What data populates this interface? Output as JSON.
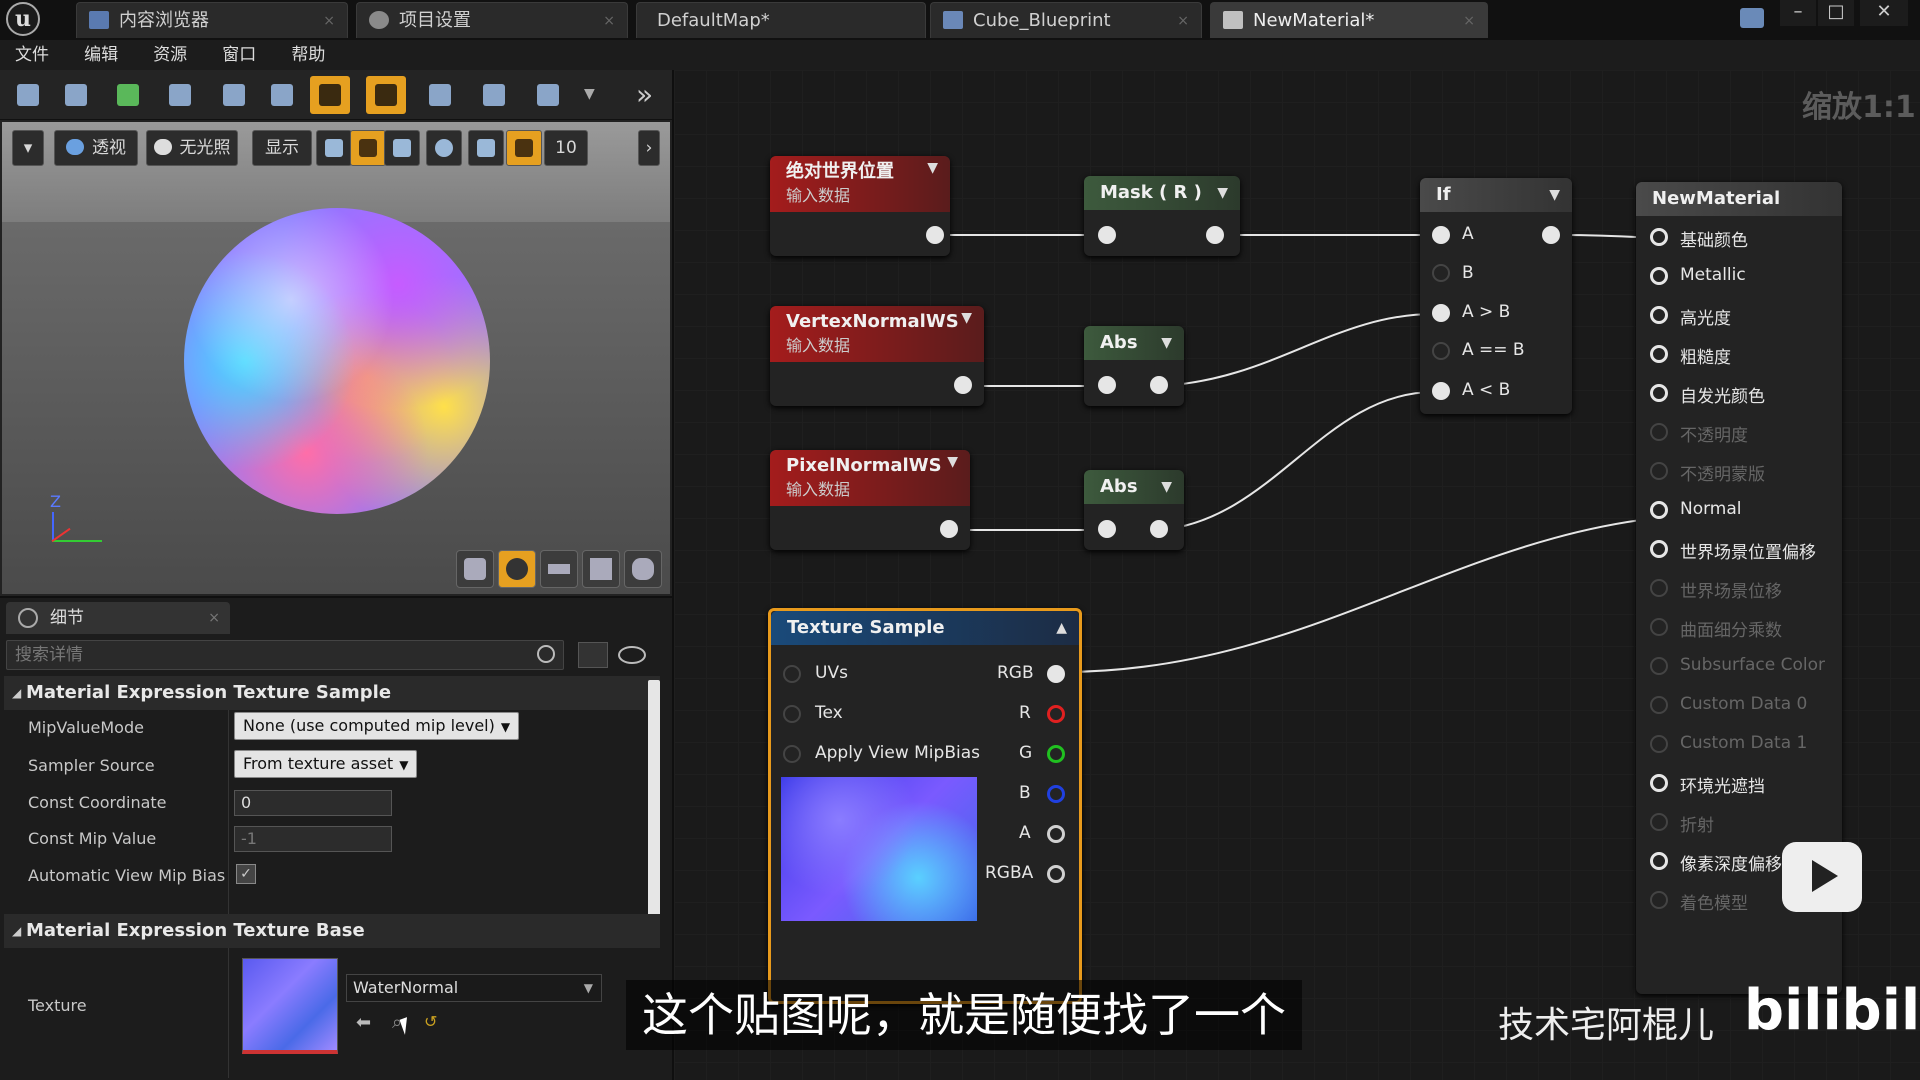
{
  "tabs": [
    {
      "label": "内容浏览器",
      "close": "×"
    },
    {
      "label": "项目设置",
      "close": "×"
    },
    {
      "label": "DefaultMap*"
    },
    {
      "label": "Cube_Blueprint",
      "close": "×"
    },
    {
      "label": "NewMaterial*",
      "close": "×"
    }
  ],
  "window": {
    "minimize": "–",
    "maximize": "□",
    "close": "✕"
  },
  "menu": [
    "文件",
    "编辑",
    "资源",
    "窗口",
    "帮助"
  ],
  "viewport": {
    "perspective": "透视",
    "lit": "无光照",
    "show": "显示",
    "grid_size": "10",
    "axis_label": "Z"
  },
  "details": {
    "tab": "细节",
    "tab_close": "×",
    "search_placeholder": "搜索详情",
    "section1": "Material Expression Texture Sample",
    "section2": "Material Expression Texture Base",
    "props": {
      "mip_value_mode": {
        "label": "MipValueMode",
        "value": "None (use computed mip level)"
      },
      "sampler_source": {
        "label": "Sampler Source",
        "value": "From texture asset"
      },
      "const_coordinate": {
        "label": "Const Coordinate",
        "value": "0"
      },
      "const_mip_value": {
        "label": "Const Mip Value",
        "value": "-1"
      },
      "auto_view_mip_bias": {
        "label": "Automatic View Mip Bias",
        "checked": true
      },
      "texture": {
        "label": "Texture",
        "value": "WaterNormal"
      }
    }
  },
  "graph": {
    "zoom": "缩放1:1",
    "nodes": {
      "abs_world_pos": {
        "title": "绝对世界位置",
        "sub": "输入数据"
      },
      "vertex_normal": {
        "title": "VertexNormalWS",
        "sub": "输入数据"
      },
      "pixel_normal": {
        "title": "PixelNormalWS",
        "sub": "输入数据"
      },
      "mask": {
        "title": "Mask ( R )"
      },
      "abs1": {
        "title": "Abs"
      },
      "abs2": {
        "title": "Abs"
      },
      "if": {
        "title": "If",
        "pins": [
          "A",
          "B",
          "A > B",
          "A == B",
          "A < B"
        ]
      },
      "texture_sample": {
        "title": "Texture Sample",
        "inputs": [
          "UVs",
          "Tex",
          "Apply View MipBias"
        ],
        "outputs": [
          "RGB",
          "R",
          "G",
          "B",
          "A",
          "RGBA"
        ]
      },
      "new_material": {
        "title": "NewMaterial",
        "pins": [
          {
            "label": "基础颜色",
            "active": true
          },
          {
            "label": "Metallic",
            "active": true
          },
          {
            "label": "高光度",
            "active": true
          },
          {
            "label": "粗糙度",
            "active": true
          },
          {
            "label": "自发光颜色",
            "active": true
          },
          {
            "label": "不透明度",
            "active": false
          },
          {
            "label": "不透明蒙版",
            "active": false
          },
          {
            "label": "Normal",
            "active": true
          },
          {
            "label": "世界场景位置偏移",
            "active": true
          },
          {
            "label": "世界场景位移",
            "active": false
          },
          {
            "label": "曲面细分乘数",
            "active": false
          },
          {
            "label": "Subsurface Color",
            "active": false
          },
          {
            "label": "Custom Data 0",
            "active": false
          },
          {
            "label": "Custom Data 1",
            "active": false
          },
          {
            "label": "环境光遮挡",
            "active": true
          },
          {
            "label": "折射",
            "active": false
          },
          {
            "label": "像素深度偏移",
            "active": true
          },
          {
            "label": "着色模型",
            "active": false
          }
        ]
      }
    }
  },
  "overlay": {
    "subtitle": "这个贴图呢，就是随便找了一个",
    "watermark": "技术宅阿棍儿",
    "logo": "bilibili"
  }
}
